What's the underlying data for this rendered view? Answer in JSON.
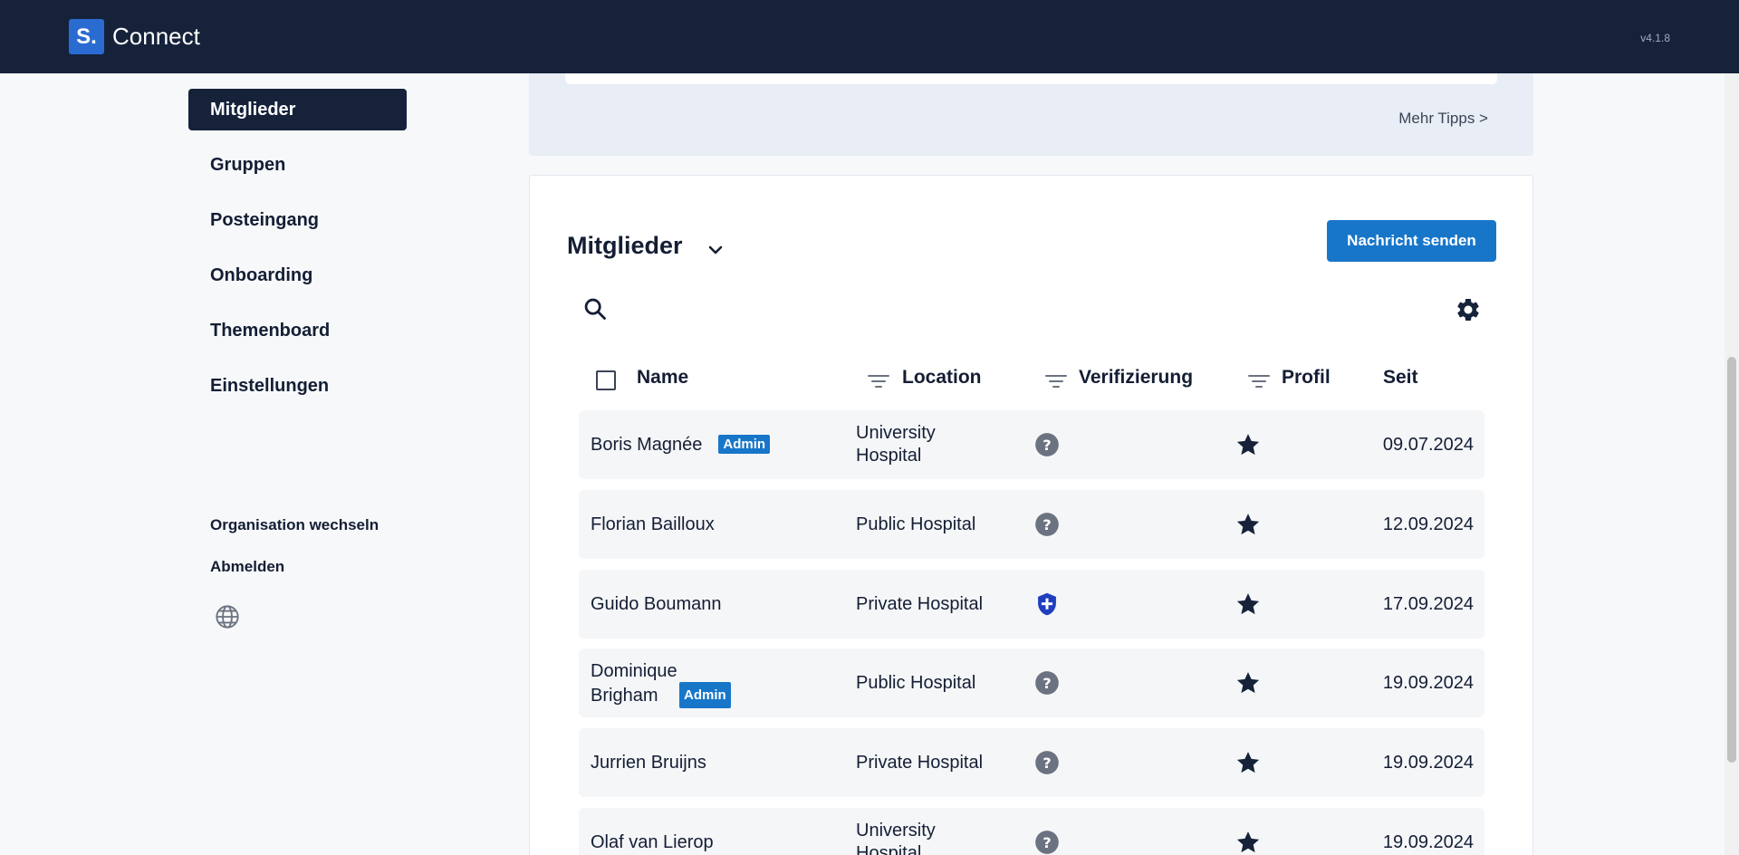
{
  "app": {
    "logo": "S.",
    "name": "Connect",
    "version": "v4.1.8"
  },
  "nav": {
    "items": [
      {
        "label": "Mitglieder",
        "active": true
      },
      {
        "label": "Gruppen"
      },
      {
        "label": "Posteingang"
      },
      {
        "label": "Onboarding"
      },
      {
        "label": "Themenboard"
      },
      {
        "label": "Einstellungen"
      }
    ],
    "switch_org": "Organisation wechseln",
    "logout": "Abmelden",
    "language_icon": "globe-icon"
  },
  "tips": {
    "more_link": "Mehr Tipps >"
  },
  "members": {
    "title": "Mitglieder",
    "send_button": "Nachricht senden",
    "columns": {
      "name": "Name",
      "location": "Location",
      "verification": "Verifizierung",
      "profile": "Profil",
      "since": "Seit"
    },
    "rows": [
      {
        "name": "Boris Magnée",
        "admin": "Admin",
        "location": "University Hospital",
        "verification": "unknown",
        "since": "09.07.2024"
      },
      {
        "name": "Florian Bailloux",
        "admin": "",
        "location": "Public Hospital",
        "verification": "unknown",
        "since": "12.09.2024"
      },
      {
        "name": "Guido Boumann",
        "admin": "",
        "location": "Private Hospital",
        "verification": "verified",
        "since": "17.09.2024"
      },
      {
        "name": "Dominique Brigham",
        "admin": "Admin",
        "location": "Public Hospital",
        "verification": "unknown",
        "since": "19.09.2024"
      },
      {
        "name": "Jurrien Bruijns",
        "admin": "",
        "location": "Private Hospital",
        "verification": "unknown",
        "since": "19.09.2024"
      },
      {
        "name": "Olaf van Lierop",
        "admin": "",
        "location": "University Hospital",
        "verification": "unknown",
        "since": "19.09.2024"
      }
    ]
  },
  "colors": {
    "topbar": "#15223a",
    "accent": "#1876c9",
    "verified": "#1f3fbf",
    "unknown": "#6b7280"
  }
}
